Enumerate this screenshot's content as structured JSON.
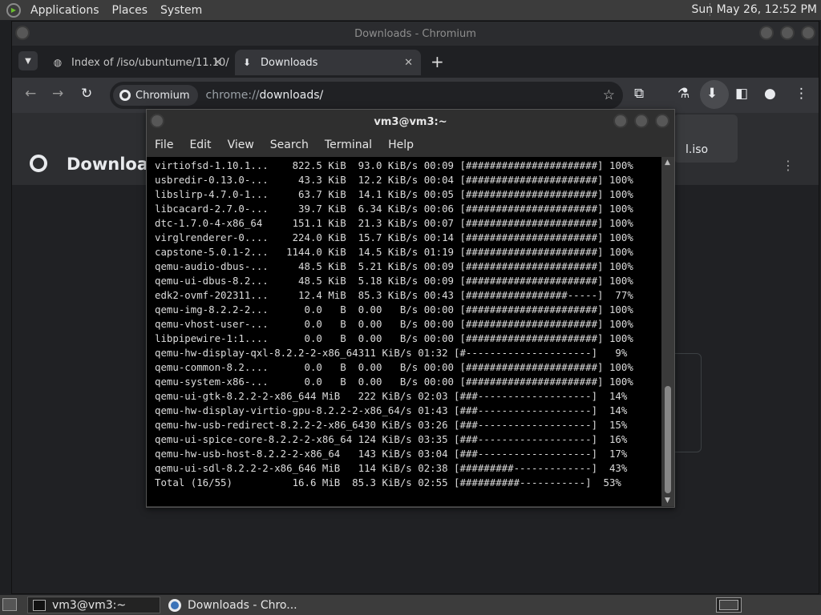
{
  "top_panel": {
    "menus": [
      "Applications",
      "Places",
      "System"
    ],
    "clock": "Sun May 26, 12:52 PM"
  },
  "chromium": {
    "window_title": "Downloads - Chromium",
    "tabs": [
      {
        "label": "Index of /iso/ubuntume/11.10/",
        "icon": "globe-icon"
      },
      {
        "label": "Downloads",
        "icon": "download-icon",
        "active": true
      }
    ],
    "omnibox_chip": "Chromium",
    "url_prefix": "chrome://",
    "url_path": "downloads/",
    "page_title": "Downloads",
    "popup_text": "l.iso"
  },
  "terminal": {
    "title": "vm3@vm3:~",
    "menu": [
      "File",
      "Edit",
      "View",
      "Search",
      "Terminal",
      "Help"
    ],
    "lines": [
      "virtiofsd-1.10.1...    822.5 KiB  93.0 KiB/s 00:09 [######################] 100%",
      "usbredir-0.13.0-...     43.3 KiB  12.2 KiB/s 00:04 [######################] 100%",
      "libslirp-4.7.0-1...     63.7 KiB  14.1 KiB/s 00:05 [######################] 100%",
      "libcacard-2.7.0-...     39.7 KiB  6.34 KiB/s 00:06 [######################] 100%",
      "dtc-1.7.0-4-x86_64     151.1 KiB  21.3 KiB/s 00:07 [######################] 100%",
      "virglrenderer-0....    224.0 KiB  15.7 KiB/s 00:14 [######################] 100%",
      "capstone-5.0.1-2...   1144.0 KiB  14.5 KiB/s 01:19 [######################] 100%",
      "qemu-audio-dbus-...     48.5 KiB  5.21 KiB/s 00:09 [######################] 100%",
      "qemu-ui-dbus-8.2...     48.5 KiB  5.18 KiB/s 00:09 [######################] 100%",
      "edk2-ovmf-202311...     12.4 MiB  85.3 KiB/s 00:43 [#################-----]  77%",
      "qemu-img-8.2.2-2...      0.0   B  0.00   B/s 00:00 [######################] 100%",
      "qemu-vhost-user-...      0.0   B  0.00   B/s 00:00 [######################] 100%",
      "libpipewire-1:1....      0.0   B  0.00   B/s 00:00 [######################] 100%",
      "qemu-hw-display-qxl-8.2.2-2-x86_64311 KiB/s 01:32 [#---------------------]   9%",
      "qemu-common-8.2....      0.0   B  0.00   B/s 00:00 [######################] 100%",
      "qemu-system-x86-...      0.0   B  0.00   B/s 00:00 [######################] 100%",
      "qemu-ui-gtk-8.2.2-2-x86_644 MiB   222 KiB/s 02:03 [###-------------------]  14%",
      "qemu-hw-display-virtio-gpu-8.2.2-2-x86_64/s 01:43 [###-------------------]  14%",
      "qemu-hw-usb-redirect-8.2.2-2-x86_6430 KiB/s 03:26 [###-------------------]  15%",
      "qemu-ui-spice-core-8.2.2-2-x86_64 124 KiB/s 03:35 [###-------------------]  16%",
      "qemu-hw-usb-host-8.2.2-2-x86_64   143 KiB/s 03:04 [###-------------------]  17%",
      "qemu-ui-sdl-8.2.2-2-x86_646 MiB   114 KiB/s 02:38 [#########-------------]  43%",
      "Total (16/55)          16.6 MiB  85.3 KiB/s 02:55 [##########-----------]  53%"
    ]
  },
  "taskbar": {
    "items": [
      {
        "label": "vm3@vm3:~"
      },
      {
        "label": "Downloads - Chro..."
      }
    ]
  }
}
